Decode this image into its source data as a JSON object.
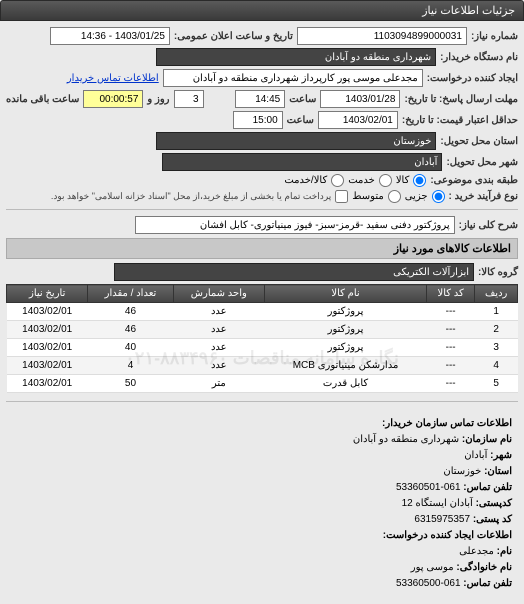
{
  "panel_title": "جزئیات اطلاعات نیاز",
  "labels": {
    "req_no": "شماره نیاز:",
    "public_dt": "تاریخ و ساعت اعلان عمومی:",
    "buyer_name": "نام دستگاه خریدار:",
    "requester": "ایجاد کننده درخواست:",
    "buyer_contact": "اطلاعات تماس خریدار",
    "deadline_to": "مهلت ارسال پاسخ: تا تاریخ:",
    "at_hour": "ساعت",
    "remain": "ساعت باقی مانده",
    "and": "روز و",
    "validity": "حداقل اعتبار قیمت: تا تاریخ:",
    "province": "استان محل تحویل:",
    "city": "شهر محل تحویل:",
    "subject_cat": "طبقه بندی موضوعی:",
    "cat_goods": "کالا",
    "cat_service": "خدمت",
    "cat_goods_service": "کالا/خدمت",
    "buy_type": "نوع فرآیند خرید :",
    "buy_partial": "جزیی",
    "buy_medium": "متوسط",
    "buy_note": "پرداخت تمام یا بخشی از مبلغ خرید،از محل \"اسناد خزانه اسلامی\" خواهد بود.",
    "gen_desc": "شرح کلی نیاز:",
    "goods_info": "اطلاعات کالاهای مورد نیاز",
    "goods_group": "گروه کالا:",
    "org_contact": "اطلاعات تماس سازمان خریدار:",
    "org_name": "نام سازمان:",
    "city2": "شهر:",
    "province2": "استان:",
    "phone": "تلفن تماس:",
    "address": "کدپستی:",
    "postal": "کد پستی:",
    "req_creator": "اطلاعات ایجاد کننده درخواست:",
    "fname": "نام:",
    "lname": "نام خانوادگی:",
    "phone2": "تلفن تماس:"
  },
  "fields": {
    "req_no": "1103094899000031",
    "public_dt": "1403/01/25 - 14:36",
    "buyer_name": "شهرداری منطقه دو آبادان",
    "requester": "مجدعلی موسی پور کارپرداز شهرداری منطقه دو آبادان",
    "deadline_date": "1403/01/28",
    "deadline_time": "14:45",
    "remain_days": "3",
    "remain_time": "00:00:57",
    "validity_date": "1403/02/01",
    "validity_time": "15:00",
    "province": "خوزستان",
    "city": "آبادان",
    "gen_desc": "پروژکتور دفنی سفید -قرمز-سبز- فیوز مینیاتوری- کابل افشان",
    "goods_group": "ابزارآلات الکتریکی"
  },
  "table": {
    "headers": [
      "ردیف",
      "کد کالا",
      "نام کالا",
      "واحد شمارش",
      "تعداد / مقدار",
      "تاریخ نیاز"
    ],
    "rows": [
      {
        "n": "1",
        "code": "---",
        "name": "پروژکتور",
        "unit": "عدد",
        "qty": "46",
        "date": "1403/02/01"
      },
      {
        "n": "2",
        "code": "---",
        "name": "پروژکتور",
        "unit": "عدد",
        "qty": "46",
        "date": "1403/02/01"
      },
      {
        "n": "3",
        "code": "---",
        "name": "پروژکتور",
        "unit": "عدد",
        "qty": "40",
        "date": "1403/02/01"
      },
      {
        "n": "4",
        "code": "---",
        "name": "مدارشکن مینیاتوری MCB",
        "unit": "عدد",
        "qty": "4",
        "date": "1403/02/01"
      },
      {
        "n": "5",
        "code": "---",
        "name": "کابل قدرت",
        "unit": "متر",
        "qty": "50",
        "date": "1403/02/01"
      }
    ],
    "watermark": "نگاره سامانه مناقصات ۸۸۳۴۹۶۰-۰۲۱"
  },
  "contact": {
    "org_name": "شهرداری منطقه دو آبادان",
    "city": "آبادان",
    "province": "خوزستان",
    "phone": "061-53360501",
    "address": "آبادان ایستگاه 12",
    "postal": "6315975357",
    "fname": "مجدعلی",
    "lname": "موسی پور",
    "phone2": "061-53360500"
  }
}
